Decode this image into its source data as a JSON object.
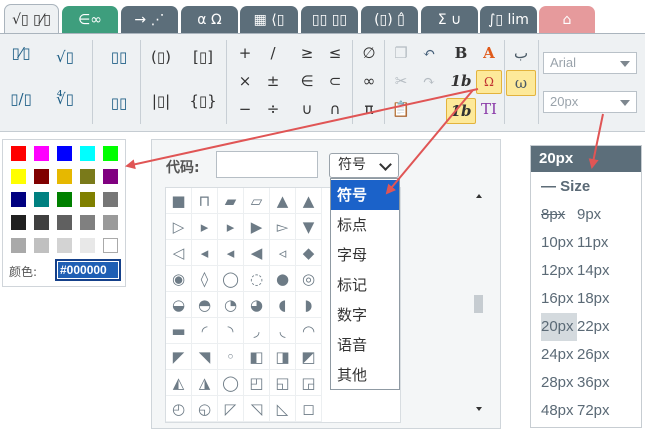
{
  "tabs": [
    {
      "label": "√▯ ▯⁄▯",
      "style": "active"
    },
    {
      "label": "∈∞",
      "style": "green"
    },
    {
      "label": "→ ⋰",
      "style": "gray"
    },
    {
      "label": "α Ω",
      "style": "gray"
    },
    {
      "label": "▦ ⟨▯",
      "style": "gray"
    },
    {
      "label": "▯▯ ▯▯",
      "style": "gray"
    },
    {
      "label": "(▯) ▯̂",
      "style": "gray"
    },
    {
      "label": "Σ ∪",
      "style": "gray"
    },
    {
      "label": "∫▯ lim",
      "style": "gray"
    },
    {
      "label": "⌂",
      "style": "red"
    }
  ],
  "toolbar": {
    "col1": [
      "▯⁄▯",
      "√▯",
      "▯/▯",
      "∜▯"
    ],
    "col2": [
      "▯▯",
      "▯▯"
    ],
    "col3": [
      "(▯)",
      "[▯]",
      "|▯|",
      "{▯}"
    ],
    "operators": [
      "+",
      "/",
      "≥",
      "≤",
      "×",
      "±",
      "∈",
      "⊂",
      "−",
      "÷",
      "∪",
      "∩"
    ],
    "misc": [
      "∅",
      "∞",
      "π"
    ],
    "bold_label": "B",
    "italic_label": "1b",
    "italic_bold_label": "1b",
    "text_label": "TI",
    "font_select": "Arial",
    "size_select": "20px"
  },
  "color_panel": {
    "swatches": [
      [
        "#ff0000",
        "#ff00ff",
        "#0000ff",
        "#00ffff",
        "#00ff00"
      ],
      [
        "#ffff00",
        "#800000",
        "#e6b800",
        "#7a7a1a",
        "#800080"
      ],
      [
        "#000080",
        "#008080",
        "#008000",
        "#808000",
        "#777777"
      ],
      [
        "#202020",
        "#404040",
        "#606060",
        "#808080",
        "#9a9a9a"
      ],
      [
        "#a9a9a9",
        "#c0c0c0",
        "#d3d3d3",
        "#e8e8e8",
        "#ffffff"
      ]
    ],
    "label": "颜色:",
    "value": "#000000"
  },
  "symbol_panel": {
    "code_label": "代码:",
    "code_value": "",
    "category_selected": "符号",
    "grid": [
      [
        "■",
        "⊓",
        "▰",
        "▱",
        "▲",
        "▲"
      ],
      [
        "▷",
        "▸",
        "▸",
        "▶",
        "▻",
        "▼"
      ],
      [
        "◁",
        "◂",
        "◂",
        "◀",
        "◃",
        "◆"
      ],
      [
        "◉",
        "◊",
        "◯",
        "◌",
        "●",
        "◎"
      ],
      [
        "◒",
        "◓",
        "◔",
        "◕",
        "◖",
        "◗"
      ],
      [
        "▬",
        "◜",
        "◝",
        "◞",
        "◟",
        "◠"
      ],
      [
        "◤",
        "◥",
        "◦",
        "◧",
        "◨",
        "◩"
      ],
      [
        "◭",
        "◮",
        "◯",
        "◰",
        "◱",
        "◲"
      ],
      [
        "◴",
        "◵",
        "◸",
        "◹",
        "◺",
        "◻"
      ]
    ],
    "dropdown": [
      "符号",
      "标点",
      "字母",
      "标记",
      "数字",
      "语音",
      "其他"
    ]
  },
  "size_panel": {
    "header": "20px",
    "rows": [
      [
        "— Size",
        ""
      ],
      [
        "8px",
        "9px"
      ],
      [
        "10px",
        "11px"
      ],
      [
        "12px",
        "14px"
      ],
      [
        "16px",
        "18px"
      ],
      [
        "20px",
        "22px"
      ],
      [
        "24px",
        "26px"
      ],
      [
        "28px",
        "36px"
      ],
      [
        "48px",
        "72px"
      ]
    ]
  },
  "colors": {
    "accent": "#1b62c9",
    "tab_green": "#3e9e7d",
    "tab_gray": "#5c6e7a",
    "arrow": "#e05555"
  }
}
